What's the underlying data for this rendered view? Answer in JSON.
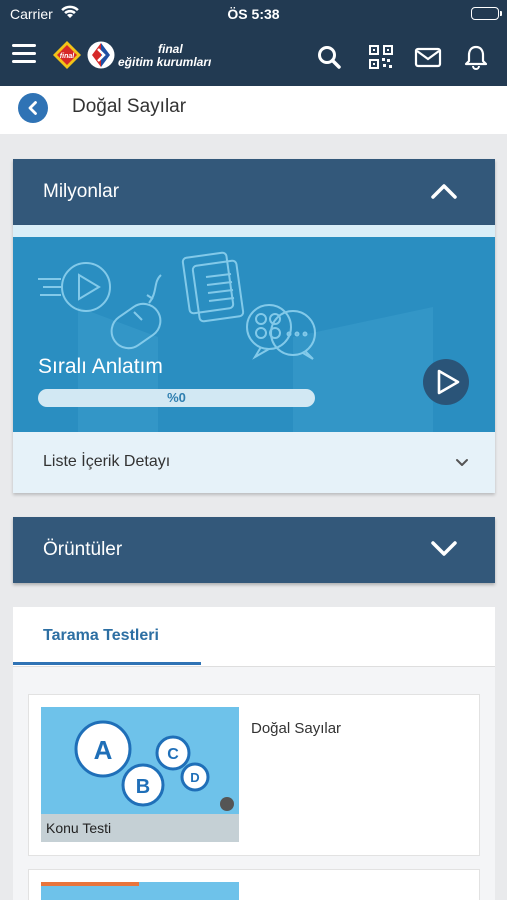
{
  "status_bar": {
    "carrier": "Carrier",
    "time": "ÖS 5:38"
  },
  "header": {
    "brand_line1": "final",
    "brand_line2": "eğitim kurumları",
    "icons": [
      "menu-icon",
      "search-icon",
      "qr-code-icon",
      "mail-icon",
      "bell-icon"
    ]
  },
  "subheader": {
    "title": "Doğal Sayılar"
  },
  "sections": [
    {
      "title": "Milyonlar",
      "expanded": true,
      "content": {
        "banner_title": "Sıralı Anlatım",
        "progress_text": "%0",
        "progress_value": 0,
        "detail_label": "Liste İçerik Detayı"
      }
    },
    {
      "title": "Örüntüler",
      "expanded": false
    }
  ],
  "tests": {
    "tab_label": "Tarama Testleri",
    "items": [
      {
        "thumb_caption": "Konu Testi",
        "thumb_letters": [
          "A",
          "B",
          "C",
          "D"
        ],
        "title": "Doğal Sayılar"
      }
    ]
  },
  "colors": {
    "header_bg": "#223a52",
    "accordion_bg": "#33587a",
    "banner_bg": "#2a8ec1",
    "accent": "#2f73b5",
    "detail_bg": "#e6f2f9"
  }
}
